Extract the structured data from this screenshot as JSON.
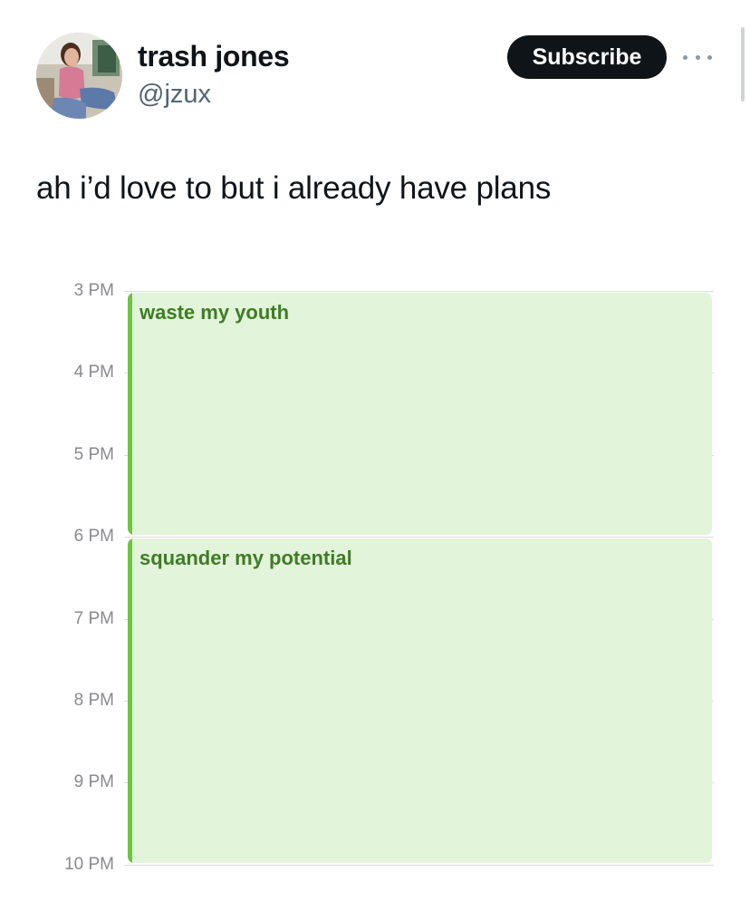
{
  "post": {
    "display_name": "trash jones",
    "handle": "@jzux",
    "subscribe_label": "Subscribe",
    "text": "ah i’d love to but i already have plans"
  },
  "calendar": {
    "hours": [
      "3 PM",
      "4 PM",
      "5 PM",
      "6 PM",
      "7 PM",
      "8 PM",
      "9 PM",
      "10 PM"
    ],
    "events": [
      {
        "title": "waste my youth",
        "start": "3 PM",
        "end": "6 PM"
      },
      {
        "title": "squander my potential",
        "start": "6 PM",
        "end": "10 PM"
      }
    ]
  },
  "colors": {
    "subscribe_bg": "#0f1419",
    "handle_text": "#536471",
    "event_fill": "#e2f4d9",
    "event_accent": "#6cc644",
    "event_text": "#3f7c26",
    "hour_text": "#8a8a8e"
  },
  "icons": {
    "more": "more-horizontal-icon",
    "avatar": "profile-photo"
  }
}
